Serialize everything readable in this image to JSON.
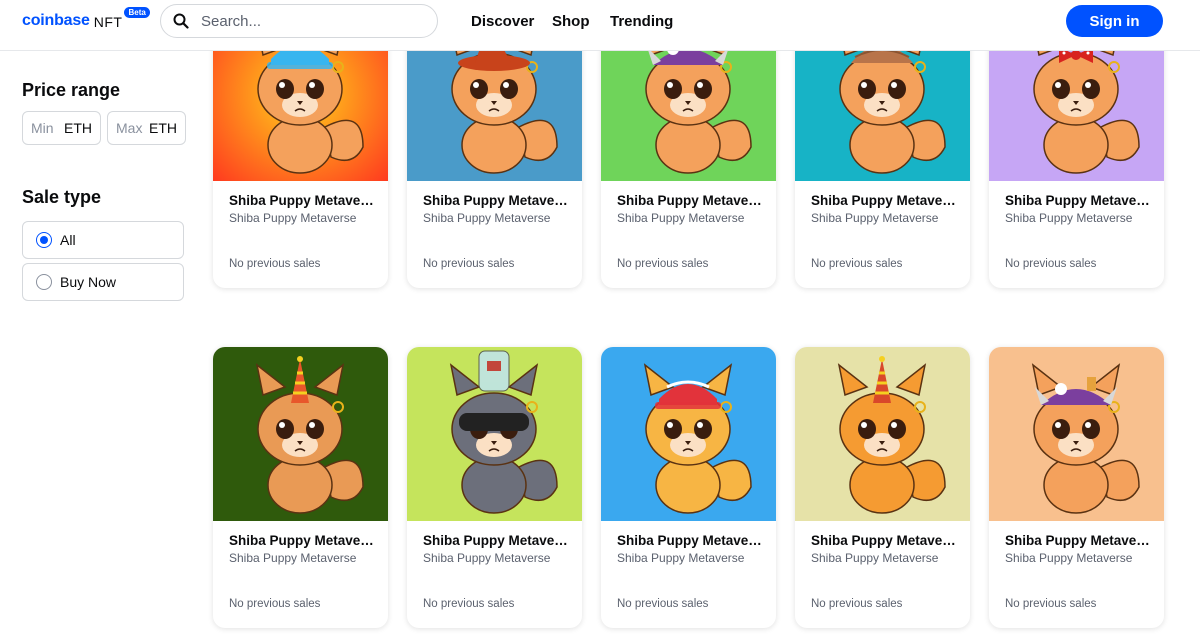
{
  "header": {
    "logo_text": "coinbase",
    "logo_suffix": "NFT",
    "beta_badge": "Beta",
    "search_placeholder": "Search...",
    "nav": [
      "Discover",
      "Shop",
      "Trending"
    ],
    "signin_label": "Sign in",
    "accent": "#0052ff"
  },
  "sidebar": {
    "price_title": "Price range",
    "min_placeholder": "Min",
    "max_placeholder": "Max",
    "currency": "ETH",
    "sale_title": "Sale type",
    "sale_options": [
      {
        "label": "All",
        "selected": true
      },
      {
        "label": "Buy Now",
        "selected": false
      }
    ]
  },
  "cards": [
    {
      "title": "Shiba Puppy Metaverse",
      "collection": "Shiba Puppy Metaverse",
      "sales": "No previous sales",
      "bg": [
        "#ff3b1f",
        "#ffd21a"
      ],
      "fur": "#f4a15c",
      "hat": "cap",
      "hat_color": "#38b5ef"
    },
    {
      "title": "Shiba Puppy Metaverse",
      "collection": "Shiba Puppy Metaverse",
      "sales": "No previous sales",
      "bg": [
        "#4a9bc9",
        "#4a9bc9"
      ],
      "fur": "#f4a15c",
      "hat": "witch",
      "hat_color": "#c8431b"
    },
    {
      "title": "Shiba Puppy Metaverse",
      "collection": "Shiba Puppy Metaverse",
      "sales": "No previous sales",
      "bg": [
        "#6fd45a",
        "#6fd45a"
      ],
      "fur": "#f4a15c",
      "hat": "helmet",
      "hat_color": "#7b3f9e"
    },
    {
      "title": "Shiba Puppy Metaverse",
      "collection": "Shiba Puppy Metaverse",
      "sales": "No previous sales",
      "bg": [
        "#17b3c6",
        "#17b3c6"
      ],
      "fur": "#f4a15c",
      "hat": "detective",
      "hat_color": "#b8744a"
    },
    {
      "title": "Shiba Puppy Metaverse",
      "collection": "Shiba Puppy Metaverse",
      "sales": "No previous sales",
      "bg": [
        "#c6a6f5",
        "#c6a6f5"
      ],
      "fur": "#f4a15c",
      "hat": "bow",
      "hat_color": "#d8231e"
    },
    {
      "title": "Shiba Puppy Metaverse",
      "collection": "Shiba Puppy Metaverse",
      "sales": "No previous sales",
      "bg": [
        "#2f5a0c",
        "#2f5a0c"
      ],
      "fur": "#e99a55",
      "hat": "party",
      "hat_color": "#e8572b"
    },
    {
      "title": "Shiba Puppy Metaverse",
      "collection": "Shiba Puppy Metaverse",
      "sales": "No previous sales",
      "bg": [
        "#c5e45c",
        "#c5e45c"
      ],
      "fur": "#6c6f7b",
      "hat": "goggles",
      "hat_color": "#222222"
    },
    {
      "title": "Shiba Puppy Metaverse",
      "collection": "Shiba Puppy Metaverse",
      "sales": "No previous sales",
      "bg": [
        "#3aa8ef",
        "#3aa8ef"
      ],
      "fur": "#f7b544",
      "hat": "cap",
      "hat_color": "#e2333b"
    },
    {
      "title": "Shiba Puppy Metaverse",
      "collection": "Shiba Puppy Metaverse",
      "sales": "No previous sales",
      "bg": [
        "#e6e2a8",
        "#e6e2a8"
      ],
      "fur": "#f59b32",
      "hat": "party",
      "hat_color": "#d9482a"
    },
    {
      "title": "Shiba Puppy Metaverse",
      "collection": "Shiba Puppy Metaverse",
      "sales": "No previous sales",
      "bg": [
        "#f8c08e",
        "#f8c08e"
      ],
      "fur": "#f4a15c",
      "hat": "helmet",
      "hat_color": "#7b3f9e"
    }
  ]
}
